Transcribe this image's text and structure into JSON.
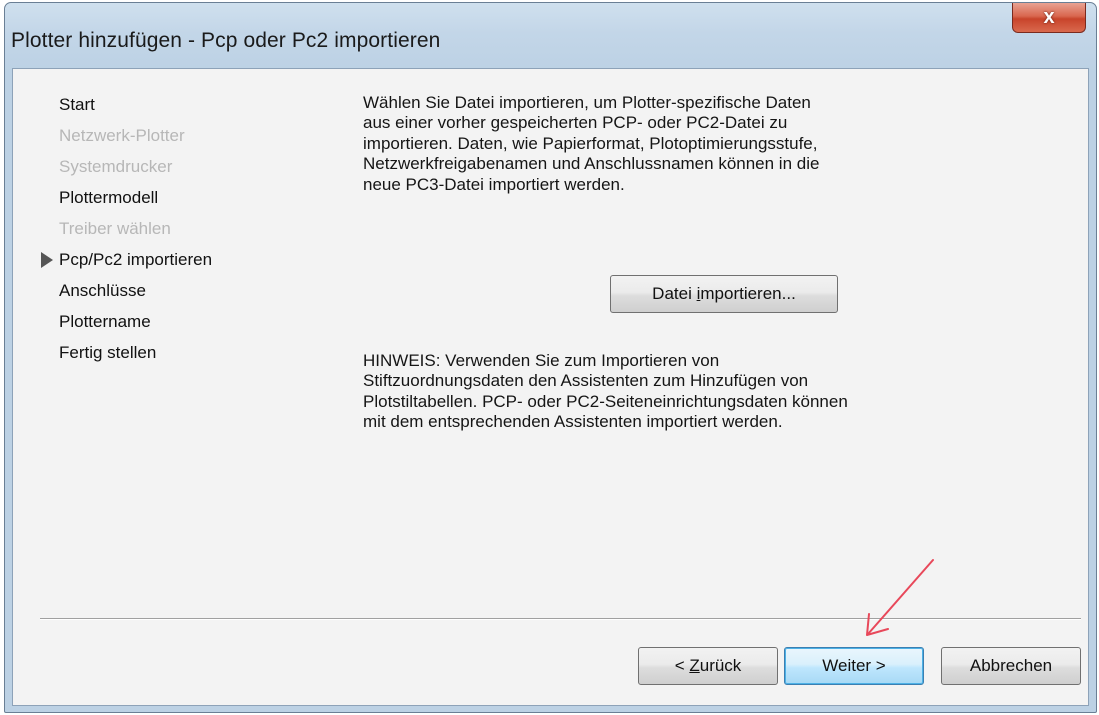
{
  "window": {
    "title": "Plotter hinzufügen - Pcp oder Pc2 importieren",
    "close_label": "x"
  },
  "steps": [
    {
      "label": "Start",
      "state": "normal"
    },
    {
      "label": "Netzwerk-Plotter",
      "state": "disabled"
    },
    {
      "label": "Systemdrucker",
      "state": "disabled"
    },
    {
      "label": "Plottermodell",
      "state": "normal"
    },
    {
      "label": "Treiber wählen",
      "state": "disabled"
    },
    {
      "label": "Pcp/Pc2 importieren",
      "state": "current"
    },
    {
      "label": "Anschlüsse",
      "state": "normal"
    },
    {
      "label": "Plottername",
      "state": "normal"
    },
    {
      "label": "Fertig stellen",
      "state": "normal"
    }
  ],
  "intro_lines": [
    "Wählen Sie Datei importieren, um Plotter-spezifische Daten",
    "aus einer vorher gespeicherten PCP- oder PC2-Datei zu",
    "importieren. Daten, wie Papierformat, Plotoptimierungsstufe,",
    "Netzwerkfreigabenamen und Anschlussnamen können in die",
    "neue PC3-Datei importiert werden."
  ],
  "import_button": {
    "before": "Datei ",
    "accel": "i",
    "after": "mportieren..."
  },
  "note_lines": [
    "HINWEIS: Verwenden Sie zum Importieren von",
    "Stiftzuordnungsdaten den Assistenten zum Hinzufügen von",
    "Plotstiltabellen. PCP- oder PC2-Seiteneinrichtungsdaten können",
    "mit dem entsprechenden Assistenten importiert werden."
  ],
  "buttons": {
    "back": {
      "prefix": "< ",
      "accel": "Z",
      "rest": "urück"
    },
    "next": "Weiter >",
    "cancel": "Abbrechen"
  },
  "colors": {
    "annotation_arrow": "#e8485a",
    "default_button_border": "#3c7fb1",
    "close_button": "#c8442b"
  },
  "icons": {
    "current_step": "triangle-right-icon",
    "close": "close-icon"
  }
}
